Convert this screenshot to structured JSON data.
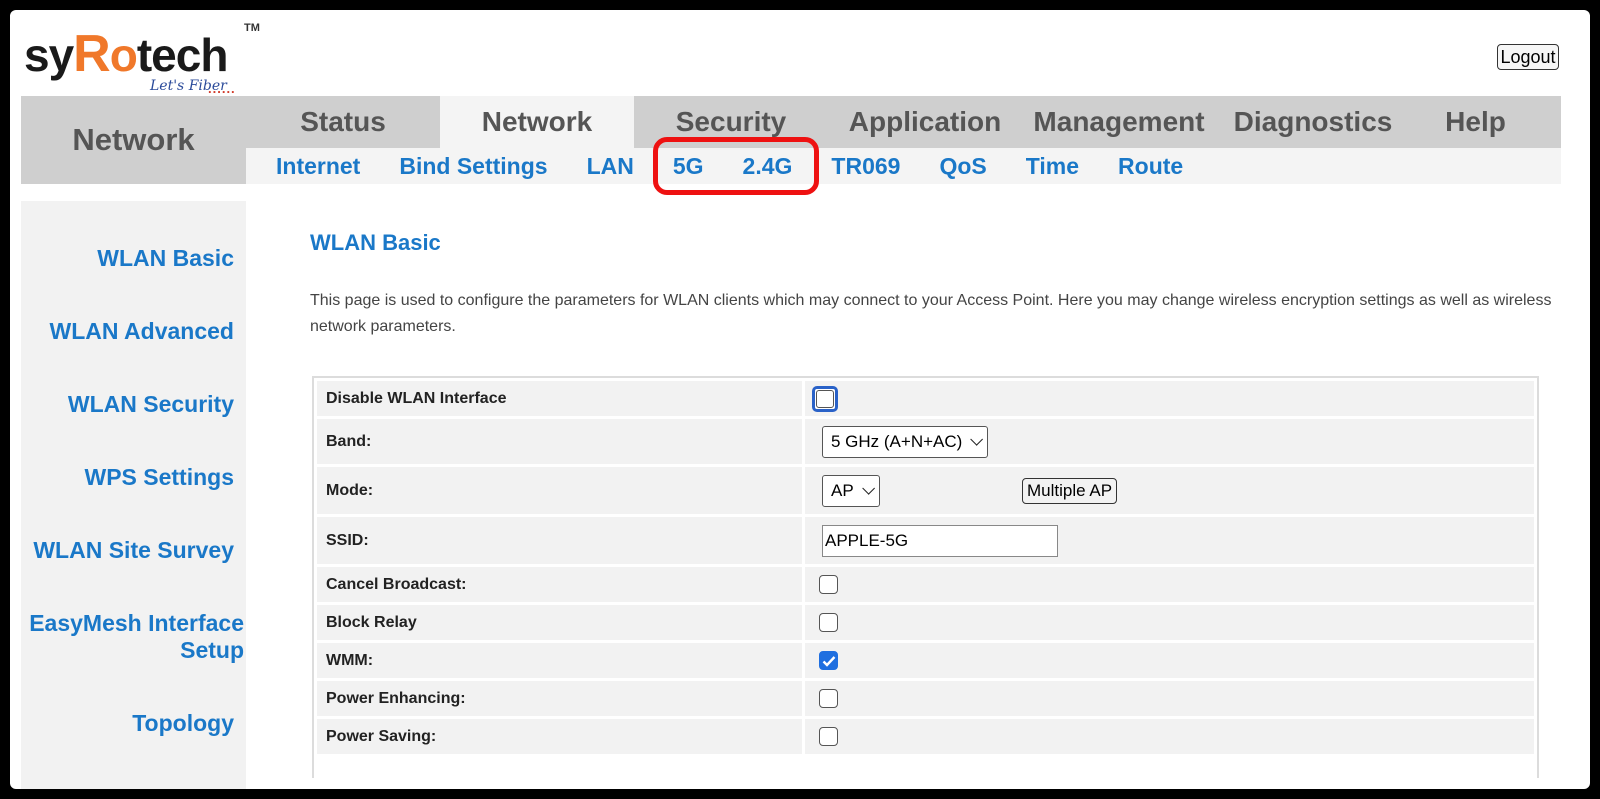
{
  "logo": {
    "brand_pre": "sy",
    "brand_r": "R",
    "brand_o": "o",
    "brand_post": "tech",
    "tm": "TM",
    "tagline": "Let's Fiber",
    "dots": "......"
  },
  "header": {
    "logout_label": "Logout",
    "section_title": "Network"
  },
  "main_tabs": [
    {
      "label": "Status"
    },
    {
      "label": "Network"
    },
    {
      "label": "Security"
    },
    {
      "label": "Application"
    },
    {
      "label": "Management"
    },
    {
      "label": "Diagnostics"
    },
    {
      "label": "Help"
    }
  ],
  "sub_tabs": [
    {
      "label": "Internet"
    },
    {
      "label": "Bind Settings"
    },
    {
      "label": "LAN"
    },
    {
      "label": "5G"
    },
    {
      "label": "2.4G"
    },
    {
      "label": "TR069"
    },
    {
      "label": "QoS"
    },
    {
      "label": "Time"
    },
    {
      "label": "Route"
    }
  ],
  "sidebar": {
    "items": [
      {
        "label": "WLAN Basic"
      },
      {
        "label": "WLAN Advanced"
      },
      {
        "label": "WLAN Security"
      },
      {
        "label": "WPS Settings"
      },
      {
        "label": "WLAN Site Survey"
      },
      {
        "label": "EasyMesh Interface",
        "label2": "Setup"
      },
      {
        "label": "Topology"
      }
    ]
  },
  "content": {
    "title": "WLAN Basic",
    "description": "This page is used to configure the parameters for WLAN clients which may connect to your Access Point. Here you may change wireless encryption settings as well as wireless network parameters."
  },
  "form": {
    "disable_wlan": {
      "label": "Disable WLAN Interface",
      "checked": false
    },
    "band": {
      "label": "Band:",
      "value": "5 GHz (A+N+AC)"
    },
    "mode": {
      "label": "Mode:",
      "value": "AP",
      "multiple_ap_label": "Multiple AP"
    },
    "ssid": {
      "label": "SSID:",
      "value": "APPLE-5G"
    },
    "cancel_broadcast": {
      "label": "Cancel Broadcast:",
      "checked": false
    },
    "block_relay": {
      "label": "Block Relay",
      "checked": false
    },
    "wmm": {
      "label": "WMM:",
      "checked": true
    },
    "power_enhancing": {
      "label": "Power Enhancing:",
      "checked": false
    },
    "power_saving": {
      "label": "Power Saving:",
      "checked": false
    }
  },
  "colors": {
    "accent": "#1a78c8",
    "highlight": "#ee1111",
    "brand_orange": "#f0782a"
  }
}
